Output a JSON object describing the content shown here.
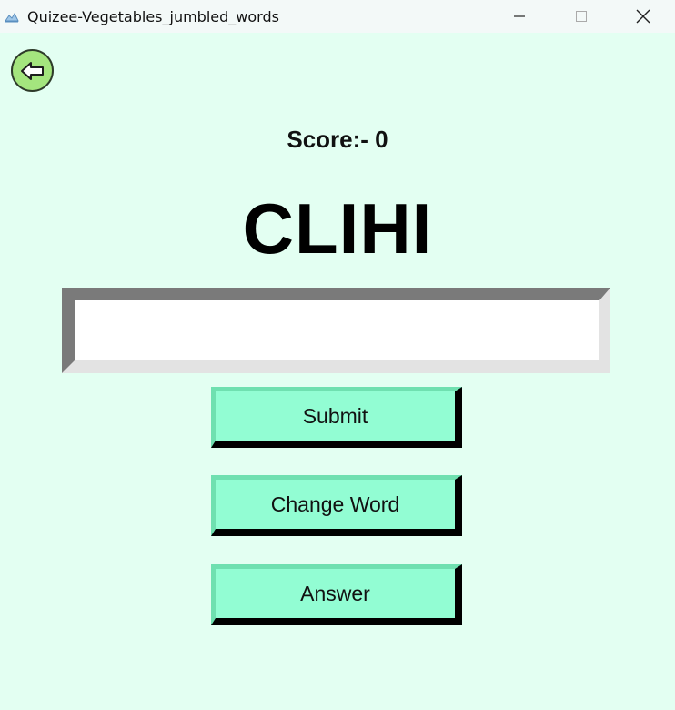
{
  "window": {
    "title": "Quizee-Vegetables_jumbled_words",
    "minimize_icon": "minimize-icon",
    "maximize_icon": "maximize-icon",
    "close_icon": "close-icon"
  },
  "back_button": {
    "icon": "arrow-left-icon"
  },
  "score_text": "Score:- 0",
  "jumbled_word": "CLIHI",
  "answer_input": {
    "value": "",
    "placeholder": ""
  },
  "buttons": {
    "submit": "Submit",
    "change_word": "Change Word",
    "answer": "Answer"
  },
  "colors": {
    "background": "#e3fff2",
    "button_fill": "#92fdd3",
    "back_button_fill": "#a4e57e"
  }
}
